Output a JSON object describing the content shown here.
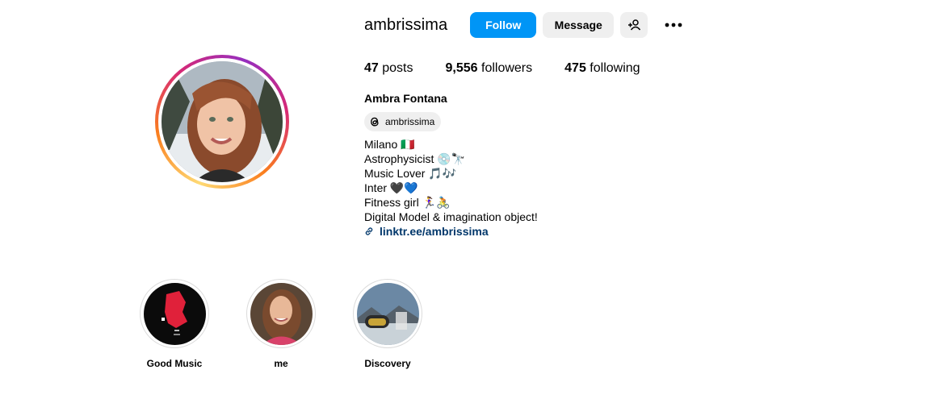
{
  "profile": {
    "username": "ambrissima",
    "follow_label": "Follow",
    "message_label": "Message",
    "posts_count": "47",
    "posts_label": "posts",
    "followers_count": "9,556",
    "followers_label": "followers",
    "following_count": "475",
    "following_label": "following",
    "full_name": "Ambra Fontana",
    "threads_handle": "ambrissima",
    "bio": [
      "Milano 🇮🇹",
      "Astrophysicist 💿🔭",
      "Music Lover 🎵🎶",
      "Inter 🖤💙",
      "Fitness girl 🏃‍♀️🚴",
      "Digital Model & imagination object!"
    ],
    "link_text": "linktr.ee/ambrissima"
  },
  "highlights": [
    {
      "label": "Good Music"
    },
    {
      "label": "me"
    },
    {
      "label": "Discovery"
    }
  ],
  "colors": {
    "follow_bg": "#0095f6",
    "button_bg": "#efefef",
    "link": "#00376b",
    "story_ring": [
      "#feda75",
      "#fa7e1e",
      "#d62976",
      "#962fbf"
    ]
  },
  "icons": [
    "add-person-icon",
    "more-icon",
    "threads-icon",
    "link-icon"
  ]
}
